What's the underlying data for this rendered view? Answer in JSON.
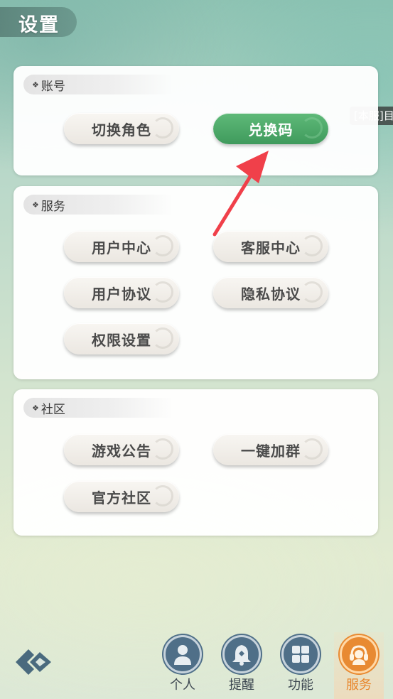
{
  "header": {
    "title": "设置"
  },
  "server_tag": "[本服]目",
  "sections": {
    "account": {
      "title": "账号",
      "buttons": {
        "switch_role": "切换角色",
        "redeem_code": "兑换码"
      }
    },
    "service": {
      "title": "服务",
      "buttons": {
        "user_center": "用户中心",
        "customer_service": "客服中心",
        "user_agreement": "用户协议",
        "privacy_agreement": "隐私协议",
        "permission_settings": "权限设置"
      }
    },
    "community": {
      "title": "社区",
      "buttons": {
        "game_announcement": "游戏公告",
        "join_group": "一键加群",
        "official_community": "官方社区"
      }
    }
  },
  "bottom_nav": {
    "personal": "个人",
    "reminder": "提醒",
    "function": "功能",
    "service": "服务",
    "active": "service"
  },
  "colors": {
    "accent_green": "#4caa68",
    "active_orange": "#e88a32",
    "nav_blue": "#4f6f88",
    "arrow_red": "#f0404a"
  },
  "icons": [
    "swirl-icon",
    "person-icon",
    "bell-icon",
    "grid-icon",
    "headset-icon",
    "logo-icon",
    "arrow-icon"
  ]
}
